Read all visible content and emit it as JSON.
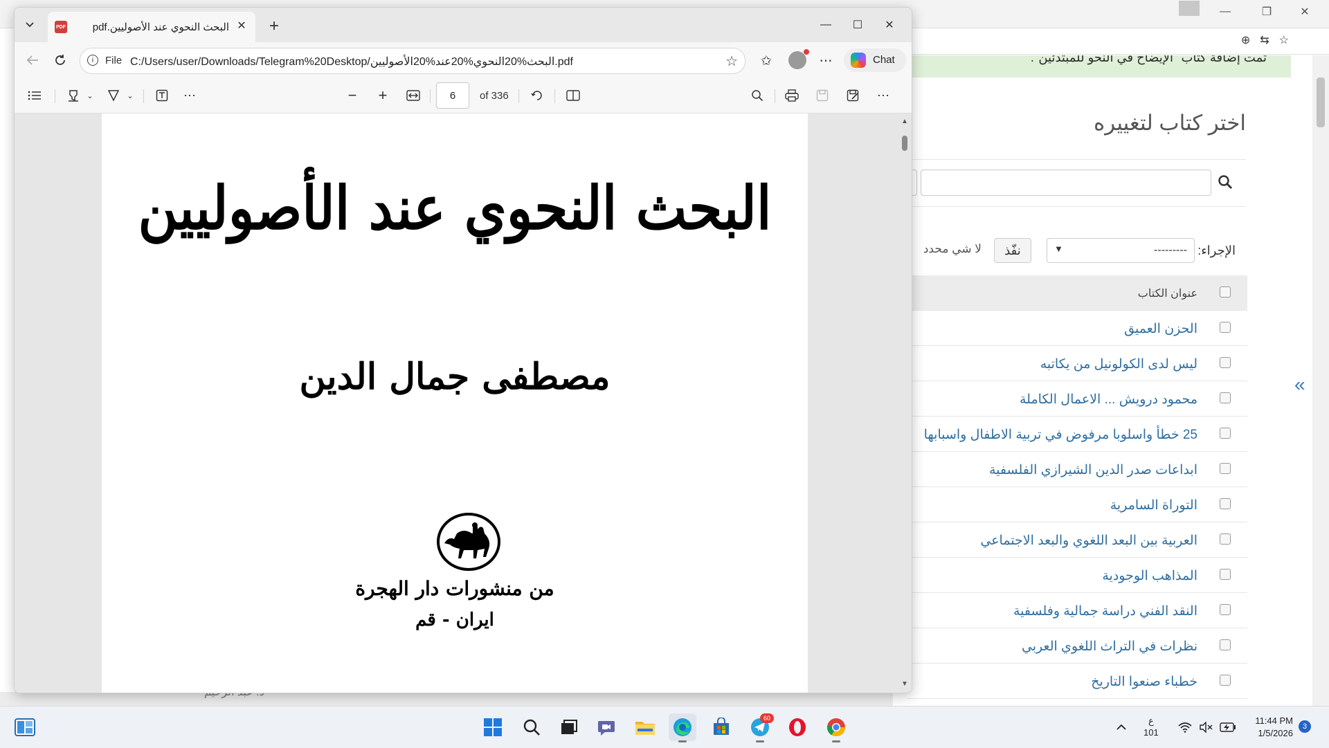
{
  "background_window": {
    "green_banner": "تمت إضافة كتاب \"الإيضاح في النحو للمبتدئين\".",
    "heading": "اختر كتاب لتغييره",
    "action_label": "الإجراء:",
    "action_select_value": "---------",
    "go_button": "نفّذ",
    "selection_status": "لا شي محدد",
    "column_header": "عنوان الكتاب",
    "books": [
      "الحزن العميق",
      "ليس لدى الكولونيل من يكاتبه",
      "محمود درويش ... الاعمال الكاملة",
      "25 خطأ واسلوبا مرفوض في تربية الاطفال واسبابها",
      "ابداعات صدر الدين الشيرازي الفلسفية",
      "التوراة السامرية",
      "العربية بين البعد اللغوي والبعد الاجتماعي",
      "المذاهب الوجودية",
      "النقد الفني دراسة جمالية وفلسفية",
      "نظرات في التراث اللغوي العربي",
      "خطباء صنعوا التاريخ"
    ],
    "bottom_text": "د. عبد الرحيم"
  },
  "edge": {
    "tab_title": "البحث النحوي عند الأصوليين.pdf",
    "url_scheme_label": "File",
    "url": "C:/Users/user/Downloads/Telegram%20Desktop/البحث%20النحوي%20عند%20الأصوليين.pdf",
    "chat_label": "Chat",
    "icons": {
      "back": "arrow-left",
      "reload": "refresh",
      "favorite": "star-outline",
      "favorites": "star-list",
      "profile": "avatar",
      "more": "ellipsis"
    }
  },
  "pdf_toolbar": {
    "current_page": "6",
    "total_pages": "of 336"
  },
  "pdf_page": {
    "title": "البحث النحوي عند الأصوليين",
    "author": "مصطفى جمال الدين",
    "publisher": "من منشورات دار الهجرة",
    "place": "ايران - قم"
  },
  "taskbar": {
    "telegram_badge": "60",
    "language_top": "ع",
    "language_bottom": "101",
    "time": "11:44 PM",
    "date": "1/5/2026",
    "notification_count": "3"
  },
  "colors": {
    "accent_blue": "#2f6ea0",
    "banner_green": "#dff0d8",
    "notification_blue": "#2563c9"
  }
}
